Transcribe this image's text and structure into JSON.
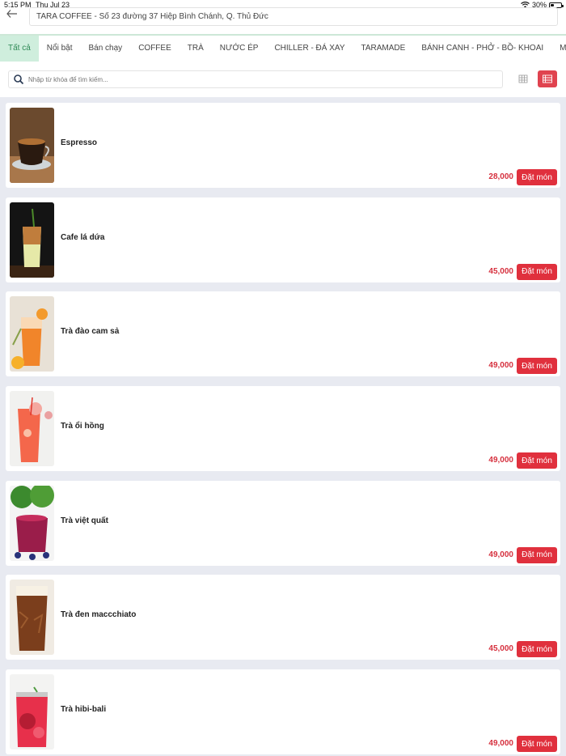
{
  "status": {
    "time": "5:15 PM",
    "date": "Thu Jul 23",
    "battery": "30%",
    "battery_level": 0.3
  },
  "header": {
    "address": "TARA COFFEE - Số 23 đường 37 Hiệp Bình Chánh, Q. Thủ Đức"
  },
  "tabs": [
    {
      "label": "Tất cả"
    },
    {
      "label": "Nổi bật"
    },
    {
      "label": "Bán chạy"
    },
    {
      "label": "COFFEE"
    },
    {
      "label": "TRÀ"
    },
    {
      "label": "NƯỚC ÉP"
    },
    {
      "label": "CHILLER - ĐÁ XAY"
    },
    {
      "label": "TARAMADE"
    },
    {
      "label": "BÁNH CANH - PHỞ - BỒ- KHOAI"
    },
    {
      "label": "MÓN THÊM"
    }
  ],
  "search": {
    "placeholder": "Nhập từ khóa để tìm kiếm..."
  },
  "colors": {
    "accent": "#e0303d",
    "tab_active_bg": "#cfeedd",
    "tab_active_text": "#2f8a56"
  },
  "products": [
    {
      "name": "Espresso",
      "price": "28,000",
      "button": "Đặt món"
    },
    {
      "name": "Cafe lá dứa",
      "price": "45,000",
      "button": "Đặt món"
    },
    {
      "name": "Trà đào cam sả",
      "price": "49,000",
      "button": "Đặt món"
    },
    {
      "name": "Trà ổi hồng",
      "price": "49,000",
      "button": "Đặt món"
    },
    {
      "name": "Trà việt quất",
      "price": "49,000",
      "button": "Đặt món"
    },
    {
      "name": "Trà đen maccchiato",
      "price": "45,000",
      "button": "Đặt món"
    },
    {
      "name": "Trà hibi-bali",
      "price": "49,000",
      "button": "Đặt món"
    }
  ]
}
